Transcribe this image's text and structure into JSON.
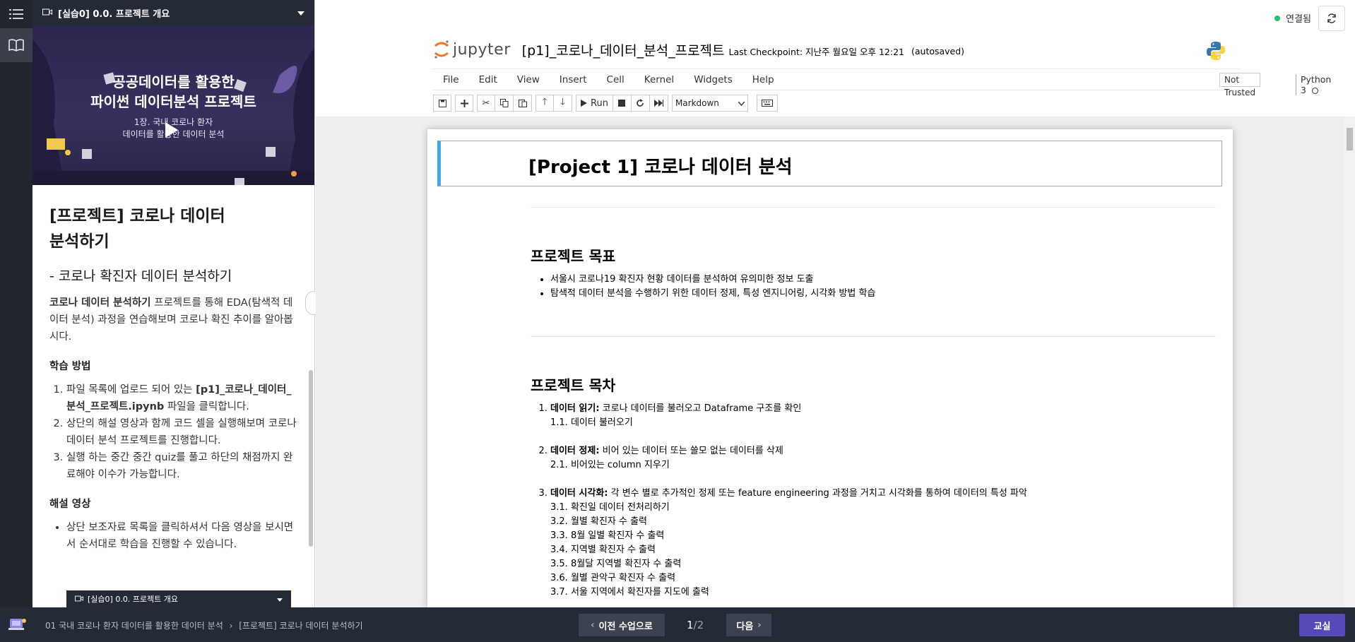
{
  "rail": {
    "icons": [
      "list-icon",
      "book-icon"
    ]
  },
  "panel": {
    "header_title": "[실습0] 0.0. 프로젝트 개요",
    "video": {
      "title_line1": "공공데이터를 활용한",
      "title_line2": "파이썬 데이터분석 프로젝트",
      "subtitle_line1": "1장. 국내 코로나 환자",
      "subtitle_line2": "데이터를 활용한 데이터 분석"
    },
    "heading_line1": "[프로젝트] 코로나 데이터",
    "heading_line2": "분석하기",
    "subheading": "- 코로나 확진자 데이터 분석하기",
    "intro_bold": "코로나 데이터 분석하기",
    "intro_rest": " 프로젝트를 통해 EDA(탐색적 데이터 분석) 과정을 연습해보며 코로나 확진 추이를 알아봅시다.",
    "method_title": "학습 방법",
    "method_steps": [
      {
        "pre": "파일 목록에 업로드 되어 있는 ",
        "bold": "[p1]_코로나_데이터_분석_프로젝트.ipynb",
        "post": " 파일을 클릭합니다."
      },
      {
        "pre": "상단의 해설 영상과 함께 코드 셀을 실행해보며 코로나 데이터 분석 프로젝트를 진행합니다.",
        "bold": "",
        "post": ""
      },
      {
        "pre": "실행 하는 중간 중간 quiz를 풀고 하단의 채점까지 완료해야 이수가 가능합니다.",
        "bold": "",
        "post": ""
      }
    ],
    "video_section_title": "해설 영상",
    "video_bullets": [
      "상단 보조자료 목록을 클릭하셔서 다음 영상을 보시면서 순서대로 학습을 진행할 수 있습니다."
    ],
    "mini_bar_title": "[실습0] 0.0. 프로젝트 개요"
  },
  "notebook": {
    "status": "연결됨",
    "logo_text": "jupyter",
    "name": "[p1]_코로나_데이터_분석_프로젝트",
    "checkpoint": "Last Checkpoint: 지난주 월요일 오후 12:21",
    "autosave": "(autosaved)",
    "menu": [
      "File",
      "Edit",
      "View",
      "Insert",
      "Cell",
      "Kernel",
      "Widgets",
      "Help"
    ],
    "trust": "Not Trusted",
    "kernel": "Python 3",
    "run_label": "Run",
    "cell_type": "Markdown",
    "title": "[Project 1] 코로나 데이터 분석",
    "goal_heading": "프로젝트 목표",
    "goals": [
      "서울시 코로나19 확진자 현황 데이터를 분석하여 유의미한 정보 도출",
      "탐색적 데이터 분석을 수행하기 위한 데이터 정제, 특성 엔지니어링, 시각화 방법 학습"
    ],
    "toc_heading": "프로젝트 목차",
    "toc": [
      {
        "bold": "데이터 읽기:",
        "text": " 코로나 데이터를 불러오고 Dataframe 구조를 확인",
        "subs": [
          "1.1. 데이터 불러오기"
        ]
      },
      {
        "bold": "데이터 정제:",
        "text": " 비어 있는 데이터 또는 쓸모 없는 데이터를 삭제",
        "subs": [
          "2.1. 비어있는 column 지우기"
        ]
      },
      {
        "bold": "데이터 시각화:",
        "text": " 각 변수 별로 추가적인 정제 또는 feature engineering 과정을 거치고 시각화를 통하여 데이터의 특성 파악",
        "subs": [
          "3.1. 확진일 데이터 전처리하기",
          "3.2. 월별 확진자 수 출력",
          "3.3. 8월 일별 확진자 수 출력",
          "3.4. 지역별 확진자 수 출력",
          "3.5. 8월달 지역별 확진자 수 출력",
          "3.6. 월별 관악구 확진자 수 출력",
          "3.7. 서울 지역에서 확진자를 지도에 출력"
        ]
      }
    ]
  },
  "bottom": {
    "crumb1": "01 국내 코로나 환자 데이터를 활용한 데이터 분석",
    "crumb_sep": "›",
    "crumb2": "[프로젝트] 코로나 데이터 분석하기",
    "prev": "이전 수업으로",
    "page_current": "1",
    "page_total": "/2",
    "next": "다음",
    "classroom": "교실"
  },
  "colors": {
    "accent": "#42a5f5",
    "connected": "#2ebd6b",
    "classroom": "#5649b8",
    "dark_bar": "#242a36"
  }
}
